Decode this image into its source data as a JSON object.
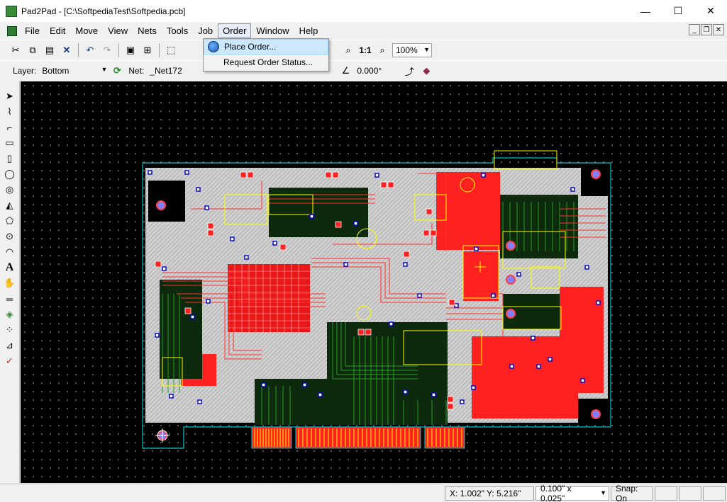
{
  "window": {
    "title": "Pad2Pad - [C:\\SoftpediaTest\\Softpedia.pcb]",
    "minimize_glyph": "—",
    "maximize_glyph": "☐",
    "close_glyph": "✕"
  },
  "menu": {
    "items": [
      {
        "name": "menu-file",
        "label": "File"
      },
      {
        "name": "menu-edit",
        "label": "Edit"
      },
      {
        "name": "menu-move",
        "label": "Move"
      },
      {
        "name": "menu-view",
        "label": "View"
      },
      {
        "name": "menu-nets",
        "label": "Nets"
      },
      {
        "name": "menu-tools",
        "label": "Tools"
      },
      {
        "name": "menu-job",
        "label": "Job"
      },
      {
        "name": "menu-order",
        "label": "Order",
        "open": true
      },
      {
        "name": "menu-window",
        "label": "Window"
      },
      {
        "name": "menu-help",
        "label": "Help"
      }
    ],
    "mdi_minimize": "_",
    "mdi_restore": "❐",
    "mdi_close": "✕"
  },
  "order_menu": {
    "items": [
      {
        "label": "Place Order...",
        "icon": "globe-icon",
        "highlighted": true
      },
      {
        "label": "Request Order Status..."
      }
    ]
  },
  "toolbar": {
    "zoom_one_label": "1:1",
    "zoom_value": "100%"
  },
  "props_bar": {
    "layer_label": "Layer:",
    "layer_value": "Bottom",
    "net_label": "Net:",
    "net_value": "_Net172",
    "angle_value": "0.000°"
  },
  "status": {
    "coords": "X: 1.002\"  Y: 5.216\"",
    "grid": "0.100\" x 0.025\"",
    "snap": "Snap: On"
  },
  "colors": {
    "copper_top": "#ff2020",
    "copper_bottom": "#1a7a1a",
    "silkscreen": "#ffff00",
    "board_outline": "#00c8c8",
    "pad_hole": "#8080ff",
    "via": "#0000c0"
  }
}
